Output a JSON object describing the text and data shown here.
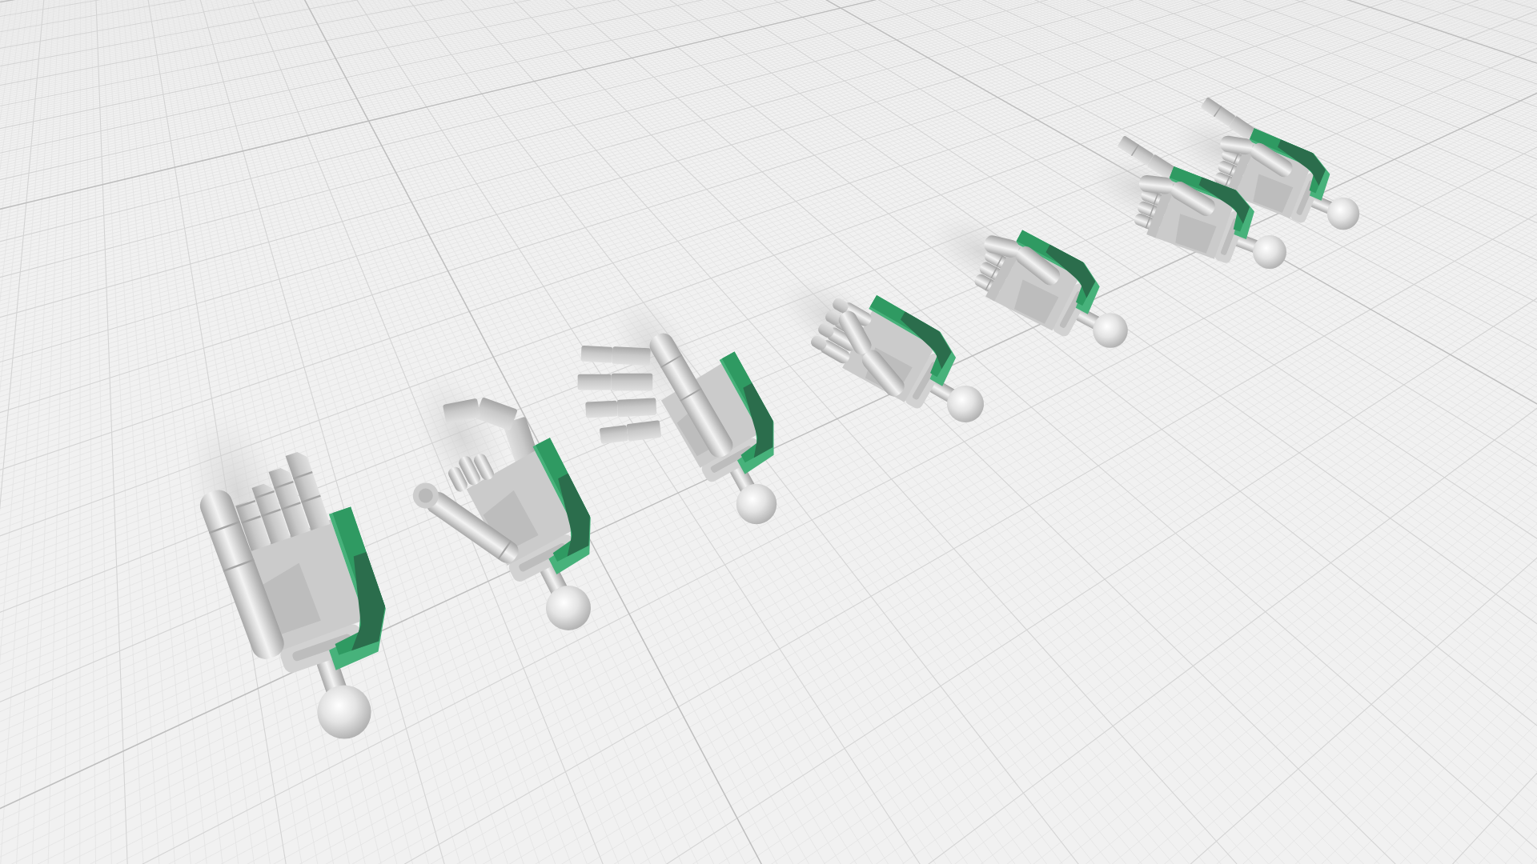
{
  "scene": {
    "hands": [
      {
        "kind": "flat"
      },
      {
        "kind": "claw"
      },
      {
        "kind": "open"
      },
      {
        "kind": "curled"
      },
      {
        "kind": "fist"
      },
      {
        "kind": "pointing"
      },
      {
        "kind": "pointing"
      }
    ]
  }
}
